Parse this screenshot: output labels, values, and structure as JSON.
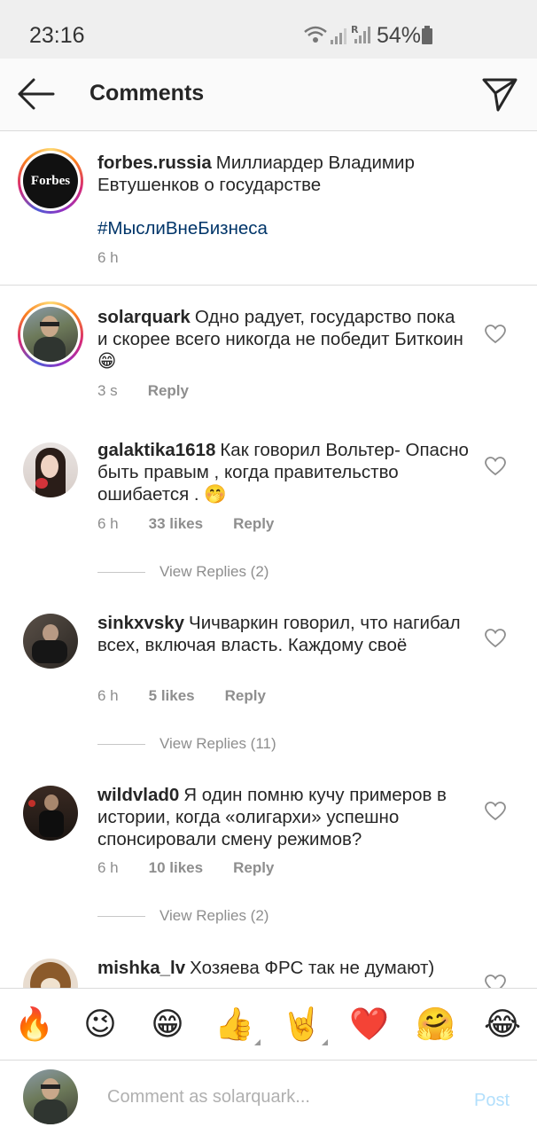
{
  "status_bar": {
    "time": "23:16",
    "battery": "54%"
  },
  "header": {
    "title": "Comments"
  },
  "caption": {
    "username": "forbes.russia",
    "text": "Миллиардер Владимир Евтушенков о государстве",
    "hashtag": "#МыслиВнеБизнеса",
    "time": "6 h",
    "avatar_text": "Forbes"
  },
  "comments": [
    {
      "username": "solarquark",
      "text": "Одно радует, государство пока и скорее всего никогда не победит Биткоин 😁",
      "time": "3 s",
      "likes": "",
      "reply": "Reply",
      "view_replies": ""
    },
    {
      "username": "galaktika1618",
      "text": "Как говорил Вольтер- Опасно быть правым , когда правительство ошибается . 🤭",
      "time": "6 h",
      "likes": "33 likes",
      "reply": "Reply",
      "view_replies": "View Replies (2)"
    },
    {
      "username": "sinkxvsky",
      "text": "Чичваркин говорил, что нагибал всех, включая власть. Каждому своё",
      "time": "6 h",
      "likes": "5 likes",
      "reply": "Reply",
      "view_replies": "View Replies (11)"
    },
    {
      "username": "wildvlad0",
      "text": "Я один помню кучу примеров в истории, когда «олигархи» успешно спонсировали смену режимов?",
      "time": "6 h",
      "likes": "10 likes",
      "reply": "Reply",
      "view_replies": "View Replies (2)"
    },
    {
      "username": "mishka_lv",
      "text": "Хозяева ФРС так не думают)",
      "time": "",
      "likes": "",
      "reply": "",
      "view_replies": ""
    }
  ],
  "emoji_bar": [
    "🔥",
    "😉",
    "😁",
    "👍",
    "🤘",
    "❤️",
    "🤗",
    "😂"
  ],
  "composer": {
    "placeholder": "Comment as solarquark...",
    "post_label": "Post"
  },
  "colors": {
    "link": "#003569",
    "muted": "#8e8e8e",
    "post_disabled": "#b2dffc"
  }
}
